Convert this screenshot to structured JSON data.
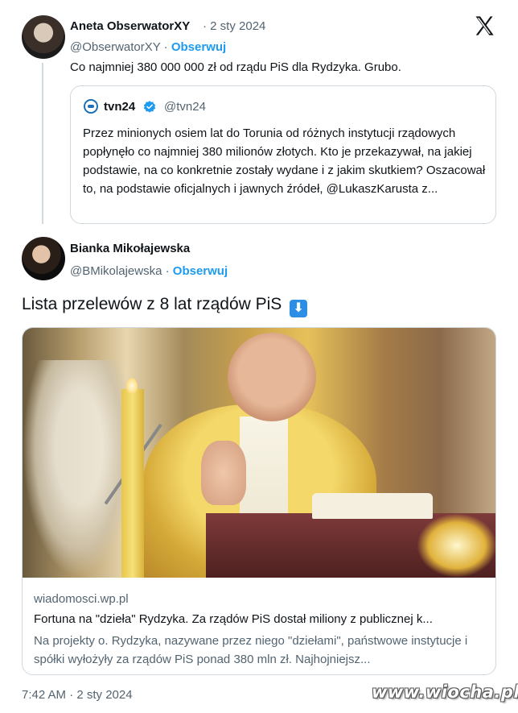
{
  "tweet1": {
    "author_name": "Aneta ObserwatorXY",
    "date": "2 sty 2024",
    "handle": "@ObserwatorXY",
    "follow_label": "Obserwuj",
    "text": "Co najmniej 380 000 000 zł od rządu PiS dla Rydzyka. Grubo.",
    "quote": {
      "source_name": "tvn24",
      "handle": "@tvn24",
      "text": "Przez minionych osiem lat do Torunia od różnych instytucji rządowych popłynęło co najmniej 380 milionów złotych. Kto je przekazywał, na jakiej podstawie, na co konkretnie zostały wydane i z jakim skutkiem? Oszacował to, na podstawie oficjalnych i jawnych źródeł, @LukaszKarusta z..."
    }
  },
  "tweet2": {
    "author_name": "Bianka Mikołajewska",
    "handle": "@BMikolajewska",
    "follow_label": "Obserwuj",
    "text": "Lista przelewów z 8 lat rządów PiS",
    "emoji": "⬇",
    "link_card": {
      "domain": "wiadomosci.wp.pl",
      "title": "Fortuna na \"dzieła\" Rydzyka. Za rządów PiS dostał miliony z publicznej k...",
      "description": "Na projekty o. Rydzyka, nazywane przez niego \"dziełami\", państwowe instytucje i spółki wyłożyły za rządów PiS ponad 380 mln zł. Najhojniejsz..."
    },
    "timestamp": "7:42 AM · 2 sty 2024"
  },
  "separator": "·",
  "watermark": "www.wiocha.pl",
  "icons": {
    "platform_logo": "x-logo-icon",
    "verified": "verified-badge-icon",
    "arrow": "down-arrow-emoji-icon"
  },
  "colors": {
    "accent": "#1d9bf0",
    "secondary_text": "#536471",
    "border": "#cfd9de"
  }
}
